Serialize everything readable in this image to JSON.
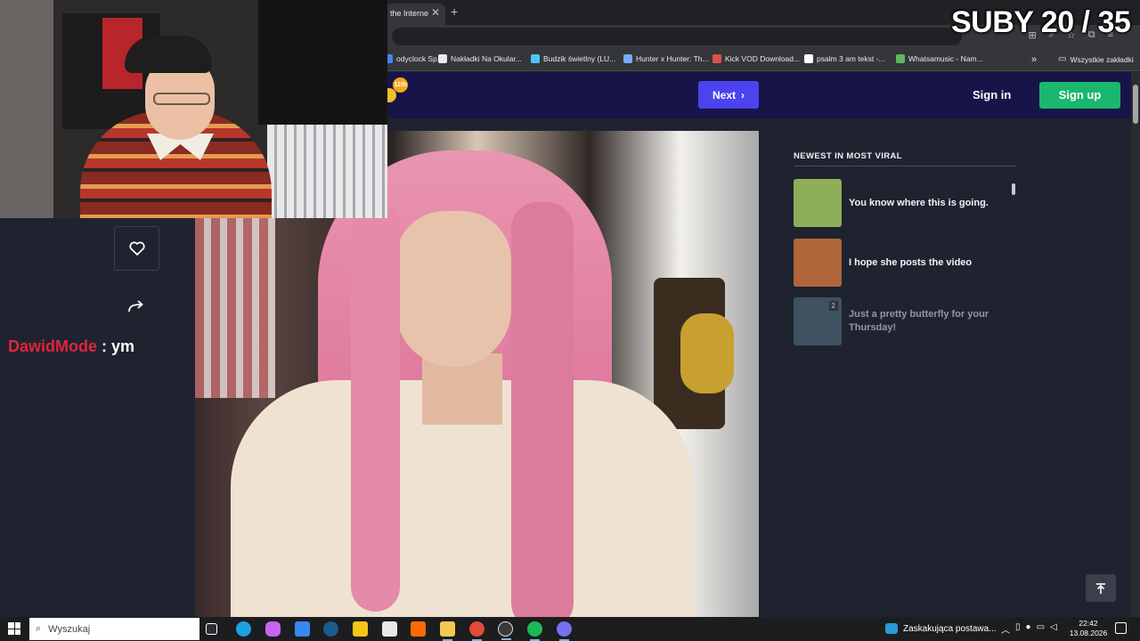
{
  "browser": {
    "active_tab_title": "the Interne",
    "bookmarks": [
      {
        "label": "odyclock Sp...",
        "color": "#4285f4"
      },
      {
        "label": "Nakładki Na Okular...",
        "color": "#e8eaed"
      },
      {
        "label": "Budzik świetlny (LU...",
        "color": "#4fc3f7"
      },
      {
        "label": "Hunter x Hunter: Th...",
        "color": "#7aa7ff"
      },
      {
        "label": "Kick VOD Download...",
        "color": "#d9534f"
      },
      {
        "label": "psalm 3 am tekst -...",
        "color": "#ffffff"
      },
      {
        "label": "Whatsamusic - Nam...",
        "color": "#5cb85c"
      }
    ],
    "bookmarks_more": "»",
    "all_bookmarks": "Wszystkie zakładki"
  },
  "site": {
    "logo_badge": "11th",
    "next_label": "Next",
    "signin_label": "Sign in",
    "signup_label": "Sign up",
    "sidebar_title": "NEWEST IN MOST VIRAL",
    "viral_items": [
      {
        "title": "You know where this is going.",
        "count": "",
        "thumb": "#8fae5a"
      },
      {
        "title": "I hope she posts the video",
        "count": "",
        "thumb": "#b0653a"
      },
      {
        "title": "Just a pretty butterfly for your Thursday!",
        "count": "2",
        "thumb": "#5a7a8a"
      }
    ]
  },
  "stream": {
    "subs_counter": "SUBY 20 / 35",
    "chat_user": "DawidMode",
    "chat_separator": " : ",
    "chat_message": "ym"
  },
  "taskbar": {
    "search_placeholder": "Wyszukaj",
    "news_text": "Zaskakująca postawa...",
    "time": "22:42",
    "date": "13.08.2026",
    "apps": [
      {
        "name": "task-view",
        "color": "#ffffff"
      },
      {
        "name": "edge",
        "color": "#1fa0e0"
      },
      {
        "name": "copilot",
        "color": "#c765f0"
      },
      {
        "name": "mail",
        "color": "#3a86f0"
      },
      {
        "name": "steam",
        "color": "#1b5c8f"
      },
      {
        "name": "app-yellow",
        "color": "#f5c518"
      },
      {
        "name": "store",
        "color": "#e8e8e8"
      },
      {
        "name": "obs-like",
        "color": "#ff6a00"
      },
      {
        "name": "files",
        "color": "#f2c94c"
      },
      {
        "name": "chrome",
        "color": "#e24a3b"
      },
      {
        "name": "obs",
        "color": "#3a3a3a"
      },
      {
        "name": "spotify",
        "color": "#1db954"
      },
      {
        "name": "discord",
        "color": "#7a6ff0"
      }
    ]
  }
}
